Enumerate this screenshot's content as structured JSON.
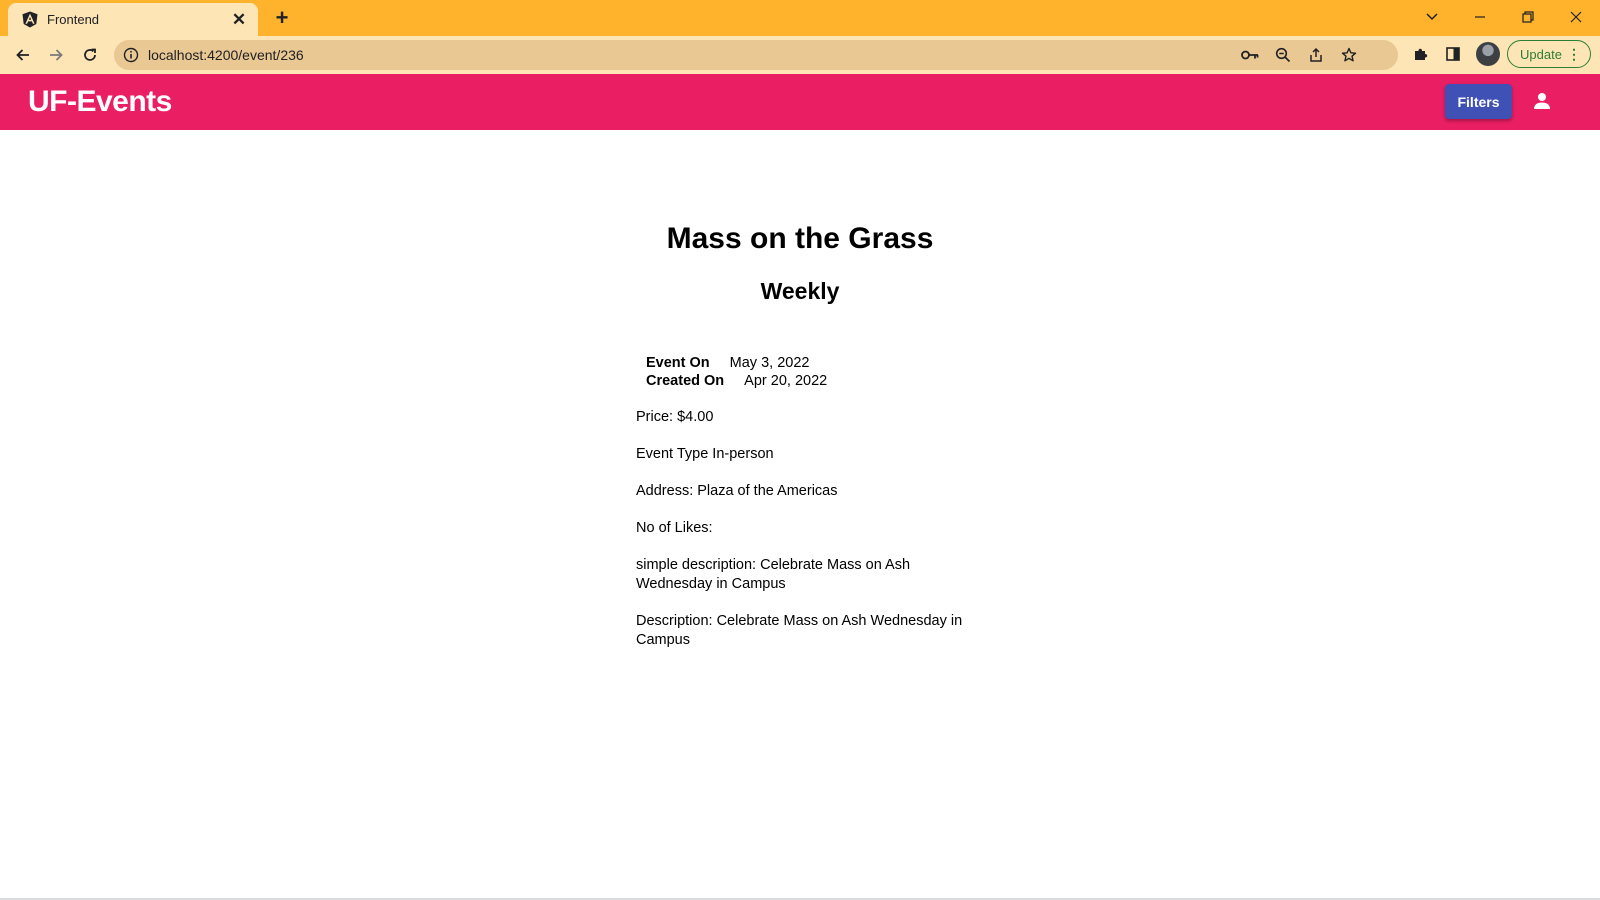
{
  "browser": {
    "tab_title": "Frontend",
    "url": "localhost:4200/event/236",
    "update_label": "Update"
  },
  "header": {
    "brand": "UF-Events",
    "filters_label": "Filters"
  },
  "event": {
    "title": "Mass on the Grass",
    "frequency": "Weekly",
    "event_on_label": "Event On",
    "event_on_value": "May 3, 2022",
    "created_on_label": "Created On",
    "created_on_value": "Apr 20, 2022",
    "price": "Price: $4.00",
    "event_type": "Event Type In-person",
    "address": "Address: Plaza of the Americas",
    "likes": "No of Likes:",
    "simple_description": "simple description: Celebrate Mass on Ash Wednesday in Campus",
    "description": "Description: Celebrate Mass on Ash Wednesday in Campus"
  },
  "colors": {
    "tab_strip": "#ffb22c",
    "toolbar": "#fde5b6",
    "header": "#e91e63",
    "filters_button": "#3f51b5"
  }
}
